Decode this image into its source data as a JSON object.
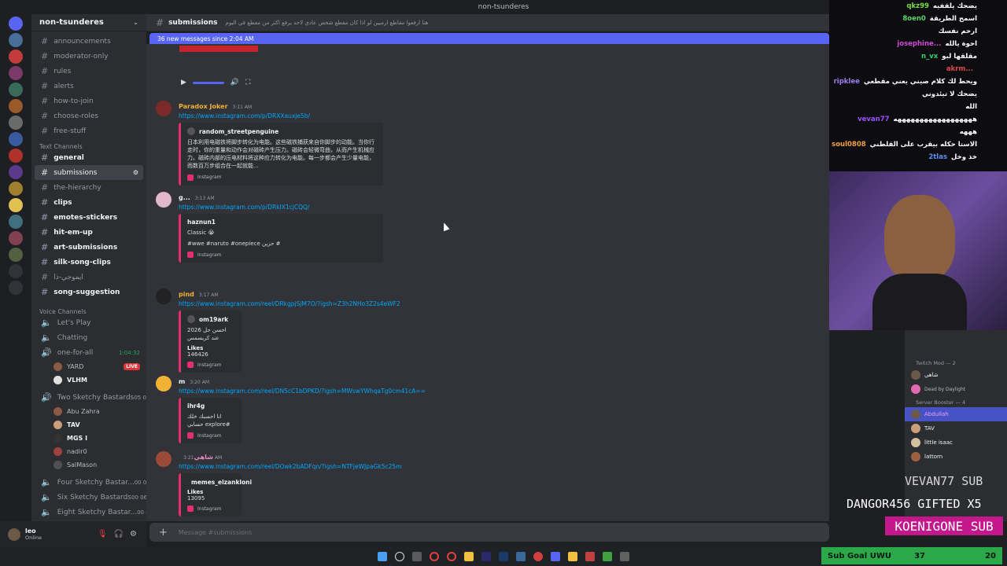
{
  "window": {
    "title": "non-tsunderes"
  },
  "server": {
    "name": "non-tsunderes"
  },
  "channels_top": [
    {
      "name": "announcements"
    },
    {
      "name": "moderator-only"
    },
    {
      "name": "rules"
    },
    {
      "name": "alerts"
    },
    {
      "name": "how-to-join"
    },
    {
      "name": "choose-roles"
    },
    {
      "name": "free-stuff"
    }
  ],
  "text_category": "Text Channels",
  "text_channels": [
    {
      "name": "general"
    },
    {
      "name": "submissions"
    },
    {
      "name": "the-hierarchy"
    },
    {
      "name": "clips"
    },
    {
      "name": "emotes-stickers"
    },
    {
      "name": "hit-em-up"
    },
    {
      "name": "art-submissions"
    },
    {
      "name": "silk-song-clips"
    },
    {
      "name": "ايموجي-ذا"
    },
    {
      "name": "song-suggestion"
    }
  ],
  "voice_category": "Voice Channels",
  "voice_channels": [
    {
      "name": "Let's Play"
    },
    {
      "name": "Chatting"
    },
    {
      "name": "one-for-all",
      "timer": "1:04:32"
    }
  ],
  "voice_users_one": [
    {
      "name": "YARD",
      "live": "LIVE"
    },
    {
      "name": "VLHM"
    }
  ],
  "voice_two": {
    "name": "Two Sketchy Bastards",
    "count": "05",
    "limit": "02"
  },
  "voice_users_two": [
    {
      "name": "Abu Zahra"
    },
    {
      "name": "TAV"
    },
    {
      "name": "MGS I"
    },
    {
      "name": "nadir0"
    },
    {
      "name": "SalMason"
    }
  ],
  "voice_more": [
    {
      "name": "Four Sketchy Bastar...",
      "count": "00",
      "limit": "04"
    },
    {
      "name": "Six Sketchy Bastards",
      "count": "00",
      "limit": "06"
    },
    {
      "name": "Eight Sketchy Bastar...",
      "count": "00",
      "limit": "08"
    }
  ],
  "user": {
    "name": "leo",
    "status": "Online"
  },
  "chat_header": {
    "channel": "submissions",
    "topic": "هنا ارفعوا مقاطع ارميين لو اذا كان مقطع شخص عادي لاحد يرفع اكثر من مقطع في اليوم"
  },
  "new_messages": "36 new messages since 2:04 AM",
  "messages": [
    {
      "user": "Paradox Joker",
      "time": "3:11 AM",
      "link": "https://www.instagram.com/p/DRXXauxje5b/",
      "embed_author": "random_streetpenguine",
      "embed_desc": "日本利用电磁铁将脚步转化为电能。这些磁铁捕获来自你脚步的动能。当你行走时，你的重量和动作会对磁砖产生压力。磁砖会轻微弯曲，从而产生机械应力。磁砖内部的压电材料将这种应力转化为电能。每一步都会产生少量电能，而数百万步组合在一起就能...",
      "embed_footer": "Instagram"
    },
    {
      "user": "g...",
      "time": "3:13 AM",
      "link": "https://www.instagram.com/p/DRkIX1cjCQQ/",
      "embed_author": "haznun1",
      "embed_desc": "Classic 😭",
      "embed_tags": "#wwe #naruto #onepiece حزين #",
      "embed_footer": "Instagram"
    },
    {
      "user": "pind",
      "time": "3:17 AM",
      "link": "https://www.instagram.com/reel/DRkgpjSjM7O/?igsh=Z3h2NHo3Z2s4eWF2",
      "embed_author": "om19ark",
      "embed_desc": "2026 احسن حل عند كريسمس",
      "embed_label": "Likes",
      "embed_value": "146426",
      "embed_footer": "Instagram"
    },
    {
      "user": "m",
      "time": "3:20 AM",
      "link": "https://www.instagram.com/reel/DN5cC1bDPKD/?igsh=MWswYWhqaTg0cm41cA==",
      "embed_author": "ihr4g",
      "embed_desc": "انا احسبك خلك حسابي explore#",
      "embed_footer": "Instagram"
    },
    {
      "user": "شاهي",
      "time": "3:21 AM",
      "link": "https://www.instagram.com/reel/DOwk2bADFqn/?igsh=NTFjeWJpaGk5c25m",
      "embed_author": "memes_elzankloni",
      "embed_label": "Likes",
      "embed_value": "13095",
      "embed_footer": "Instagram"
    }
  ],
  "composer": {
    "placeholder": "Message #submissions"
  },
  "twitch_chat": [
    {
      "name": "qkz99",
      "text": "يضحك يلقفيه",
      "color": "#7bdc4a"
    },
    {
      "name": "8oen0",
      "text": "اسمح الطريقة",
      "color": "#5ad36a"
    },
    {
      "name": "",
      "text": "ارحم نفسك",
      "color": "#ffffff"
    },
    {
      "name": "josephine...",
      "text": "احوة يالله",
      "color": "#d04bd4"
    },
    {
      "name": "n_vx",
      "text": "مقلقها لبو",
      "color": "#2fd36a"
    },
    {
      "name": "akrm...",
      "text": "",
      "color": "#e04848"
    },
    {
      "name": "ripklee",
      "text": "ويحط لك كلام صيني يعني مقطعي",
      "color": "#9a7ef0"
    },
    {
      "name": "",
      "text": "يضحك لا تيئدوني",
      "color": "#ffffff"
    },
    {
      "name": "",
      "text": "الله",
      "color": "#ffffff"
    },
    {
      "name": "vevan77",
      "text": "ههههههههههههههههههه",
      "color": "#a050ff"
    },
    {
      "name": "",
      "text": "هههه",
      "color": "#ffffff"
    },
    {
      "name": "soul0808",
      "text": "الاستا حكله بيقرب على القلطني",
      "color": "#f0a040"
    },
    {
      "name": "2tlas",
      "text": "خذ وخل",
      "color": "#5b8ef0"
    }
  ],
  "member_roles": [
    {
      "role": "Twitch Mod — 2",
      "members": [
        {
          "name": "شاهي"
        },
        {
          "name": "Dead by Daylight"
        }
      ]
    },
    {
      "role": "Server Booster — 4",
      "members": [
        {
          "name": "Abdullah"
        },
        {
          "name": "TAV"
        },
        {
          "name": "little isaac"
        },
        {
          "name": "lattorn"
        }
      ]
    }
  ],
  "overlay": {
    "sub1": "VEVAN77 SUB",
    "gifted": "DANGOR456 GIFTED X5",
    "sub2": "KOENIGONE SUB"
  },
  "sub_goal": {
    "label": "Sub Goal UWU",
    "current": "37",
    "target": "20"
  }
}
